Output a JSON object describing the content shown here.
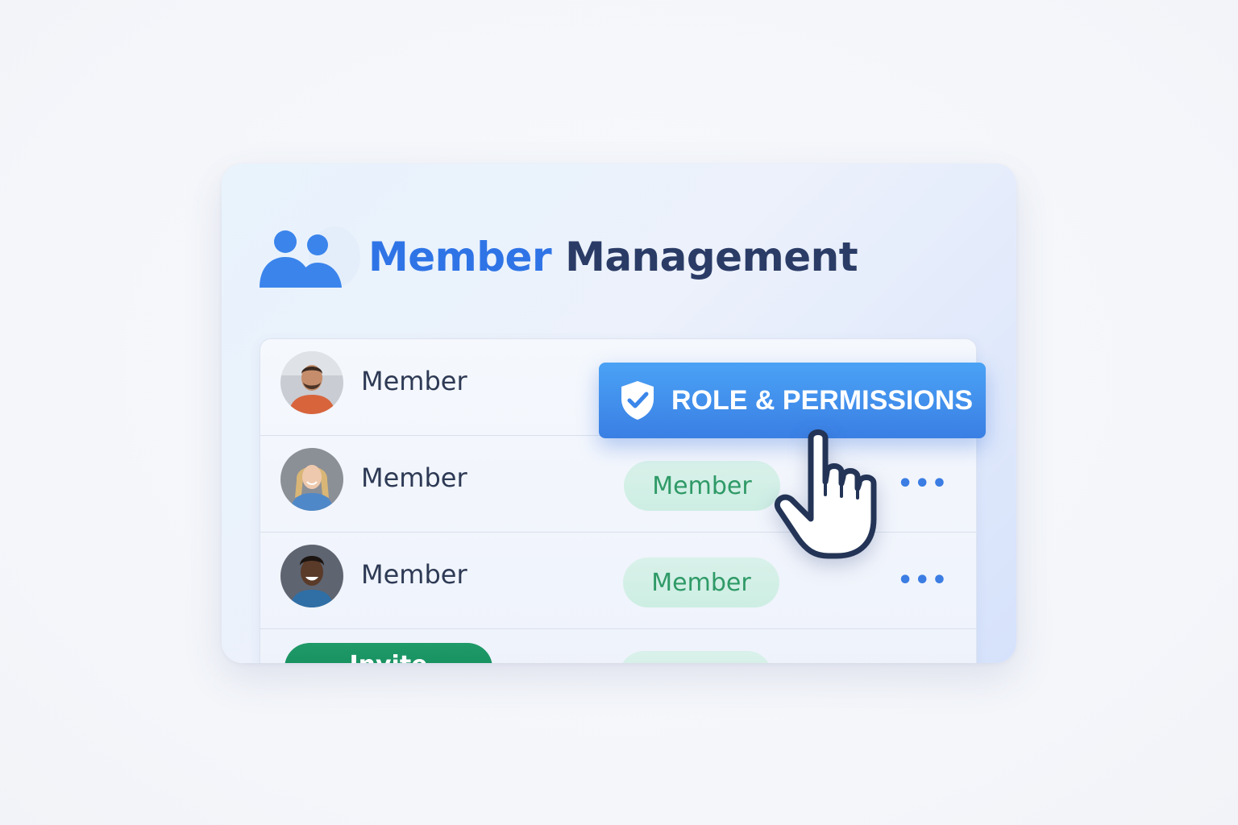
{
  "header": {
    "title_part1": "Member",
    "title_part2": "Management",
    "icon": "users-icon"
  },
  "members": [
    {
      "name": "Member",
      "role": ""
    },
    {
      "name": "Member",
      "role": "Member"
    },
    {
      "name": "Member",
      "role": "Member"
    }
  ],
  "last_row": {
    "invite_label": "Invite"
  },
  "role_button": {
    "label": "ROLE & PERMISSIONS",
    "icon": "shield-check-icon"
  },
  "more_label": "•••",
  "colors": {
    "accent_blue": "#2f74e6",
    "title_dark": "#2a3c66",
    "role_pill_text": "#2f9a67",
    "invite_green": "#12875a"
  }
}
